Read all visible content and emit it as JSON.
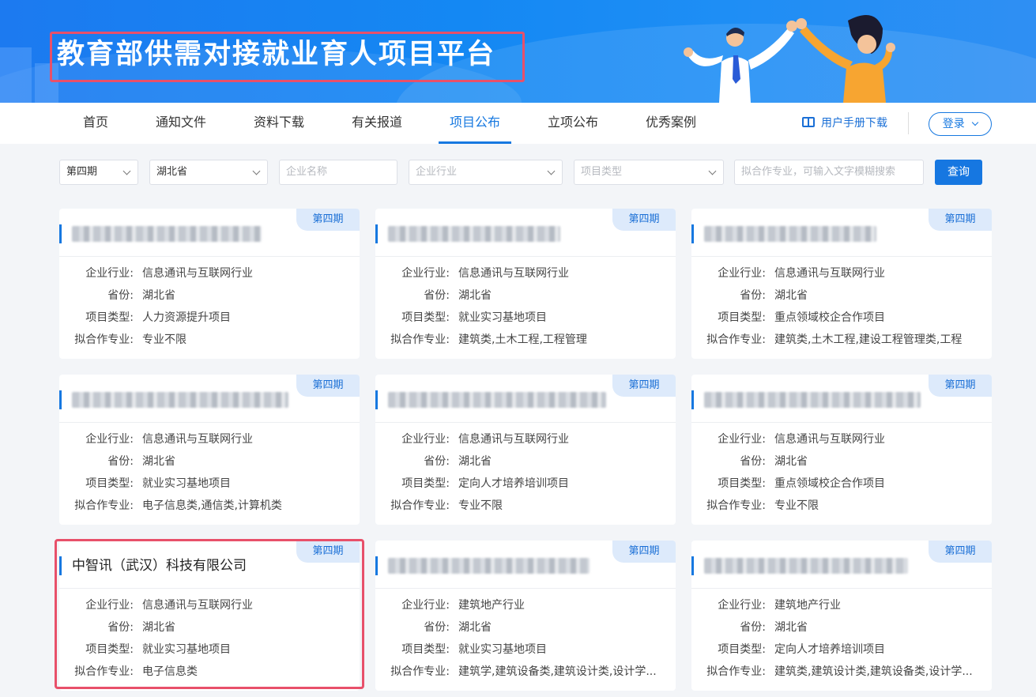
{
  "banner": {
    "title": "教育部供需对接就业育人项目平台"
  },
  "nav": {
    "items": [
      "首页",
      "通知文件",
      "资料下载",
      "有关报道",
      "项目公布",
      "立项公布",
      "优秀案例"
    ],
    "active": "项目公布",
    "manual": "用户手册下载",
    "login": "登录"
  },
  "filters": {
    "period": "第四期",
    "province": "湖北省",
    "company_placeholder": "企业名称",
    "industry_placeholder": "企业行业",
    "type_placeholder": "项目类型",
    "major_placeholder": "拟合作专业，可输入文字模糊搜索",
    "query": "查询"
  },
  "labels": {
    "industry": "企业行业:",
    "province": "省份:",
    "type": "项目类型:",
    "major": "拟合作专业:"
  },
  "cards": [
    {
      "badge": "第四期",
      "name": "",
      "industry": "信息通讯与互联网行业",
      "province": "湖北省",
      "type": "人力资源提升项目",
      "major": "专业不限"
    },
    {
      "badge": "第四期",
      "name": "",
      "industry": "信息通讯与互联网行业",
      "province": "湖北省",
      "type": "就业实习基地项目",
      "major": "建筑类,土木工程,工程管理"
    },
    {
      "badge": "第四期",
      "name": "",
      "industry": "信息通讯与互联网行业",
      "province": "湖北省",
      "type": "重点领域校企合作项目",
      "major": "建筑类,土木工程,建设工程管理类,工程"
    },
    {
      "badge": "第四期",
      "name": "",
      "industry": "信息通讯与互联网行业",
      "province": "湖北省",
      "type": "就业实习基地项目",
      "major": "电子信息类,通信类,计算机类"
    },
    {
      "badge": "第四期",
      "name": "",
      "industry": "信息通讯与互联网行业",
      "province": "湖北省",
      "type": "定向人才培养培训项目",
      "major": "专业不限"
    },
    {
      "badge": "第四期",
      "name": "",
      "industry": "信息通讯与互联网行业",
      "province": "湖北省",
      "type": "重点领域校企合作项目",
      "major": "专业不限"
    },
    {
      "badge": "第四期",
      "name": "中智讯（武汉）科技有限公司",
      "industry": "信息通讯与互联网行业",
      "province": "湖北省",
      "type": "就业实习基地项目",
      "major": "电子信息类"
    },
    {
      "badge": "第四期",
      "name": "",
      "industry": "建筑地产行业",
      "province": "湖北省",
      "type": "就业实习基地项目",
      "major": "建筑学,建筑设备类,建筑设计类,设计学..."
    },
    {
      "badge": "第四期",
      "name": "",
      "industry": "建筑地产行业",
      "province": "湖北省",
      "type": "定向人才培养培训项目",
      "major": "建筑类,建筑设计类,建筑设备类,设计学..."
    }
  ]
}
